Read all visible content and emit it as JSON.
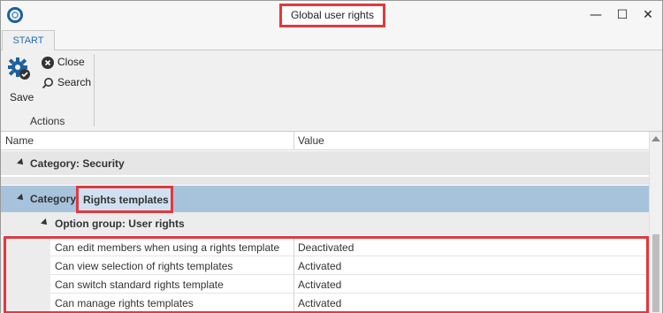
{
  "window": {
    "title": "Global user rights",
    "minimize": "—",
    "maximize": "☐",
    "close": "✕"
  },
  "ribbon": {
    "tab": "START",
    "save_label": "Save",
    "close_label": "Close",
    "search_label": "Search",
    "group_label": "Actions"
  },
  "grid": {
    "columns": [
      "Name",
      "Value"
    ],
    "categories": [
      {
        "label": "Category: Security"
      },
      {
        "label_prefix": "Category: ",
        "label_highlight": "Rights templates"
      }
    ],
    "option_group": "Option group: User rights",
    "rows": [
      {
        "name": "Can edit members when using a rights template",
        "value": "Deactivated"
      },
      {
        "name": "Can view selection of rights templates",
        "value": "Activated"
      },
      {
        "name": "Can switch standard rights template",
        "value": "Activated"
      },
      {
        "name": "Can manage rights templates",
        "value": "Activated"
      }
    ]
  },
  "colors": {
    "highlight_border": "#e0393e",
    "selected_row": "#a7c3dc",
    "accent": "#1f5f9c"
  }
}
